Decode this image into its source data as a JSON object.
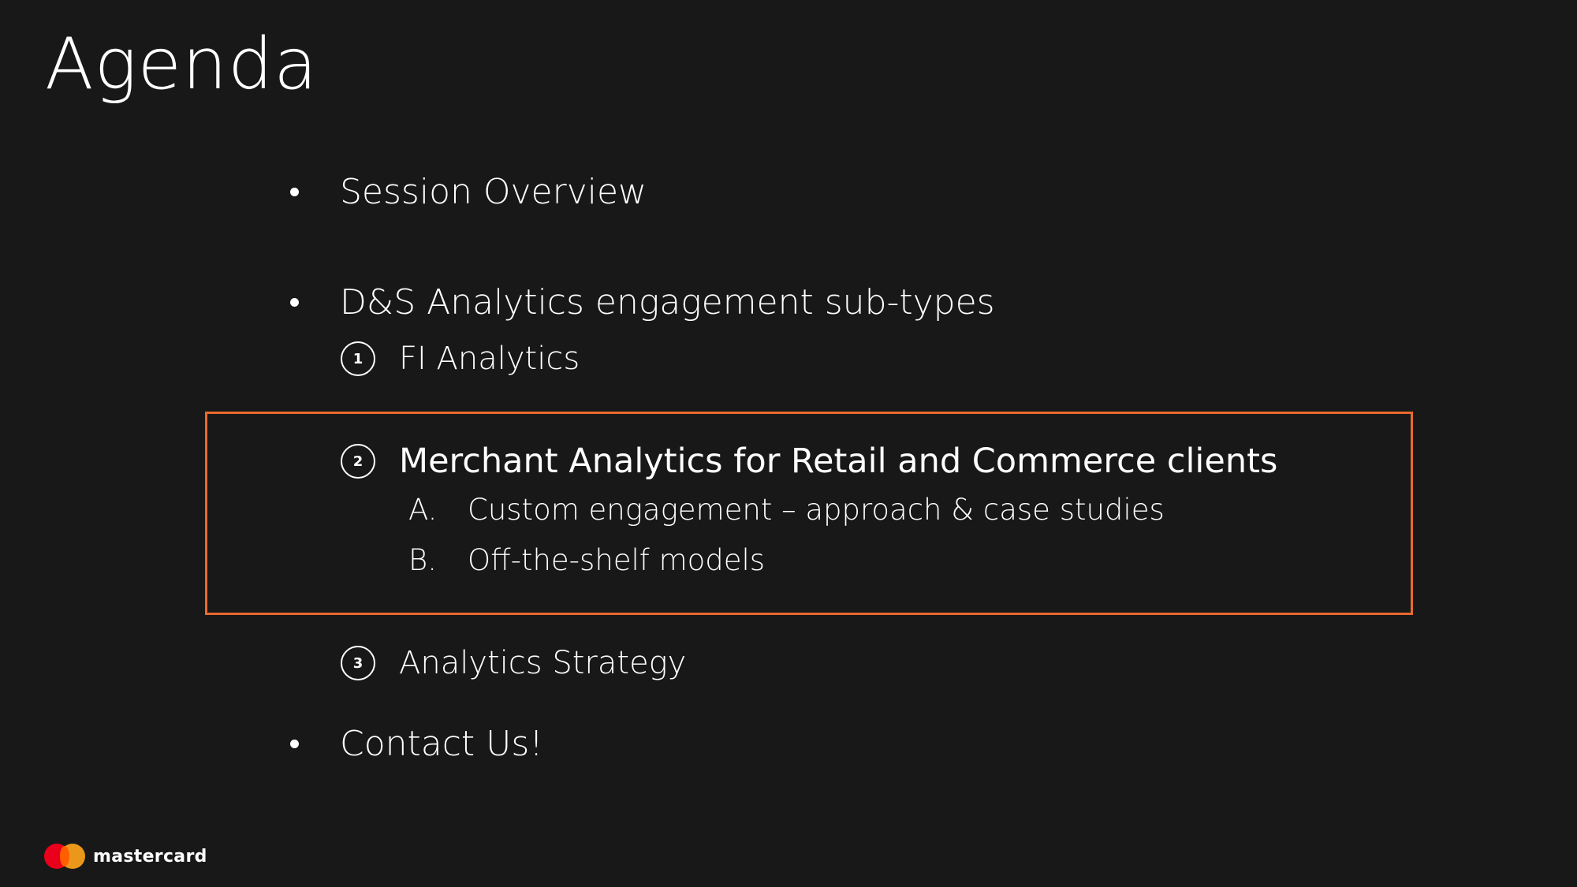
{
  "slide": {
    "title": "Agenda",
    "accent_color": "#e8692e",
    "bullets": [
      {
        "label": "Session Overview"
      },
      {
        "label": "D&S Analytics engagement sub-types"
      },
      {
        "label": "Contact Us!"
      }
    ],
    "subtypes": [
      {
        "number": "1",
        "label": "FI Analytics"
      },
      {
        "number": "2",
        "label": "Merchant Analytics for Retail and Commerce clients"
      },
      {
        "number": "3",
        "label": "Analytics Strategy"
      }
    ],
    "sub_items": [
      {
        "letter": "A.",
        "label": "Custom engagement – approach & case studies"
      },
      {
        "letter": "B.",
        "label": "Off-the-shelf models"
      }
    ],
    "logo": {
      "text": "mastercard",
      "icon": "mastercard-logo-icon"
    }
  }
}
